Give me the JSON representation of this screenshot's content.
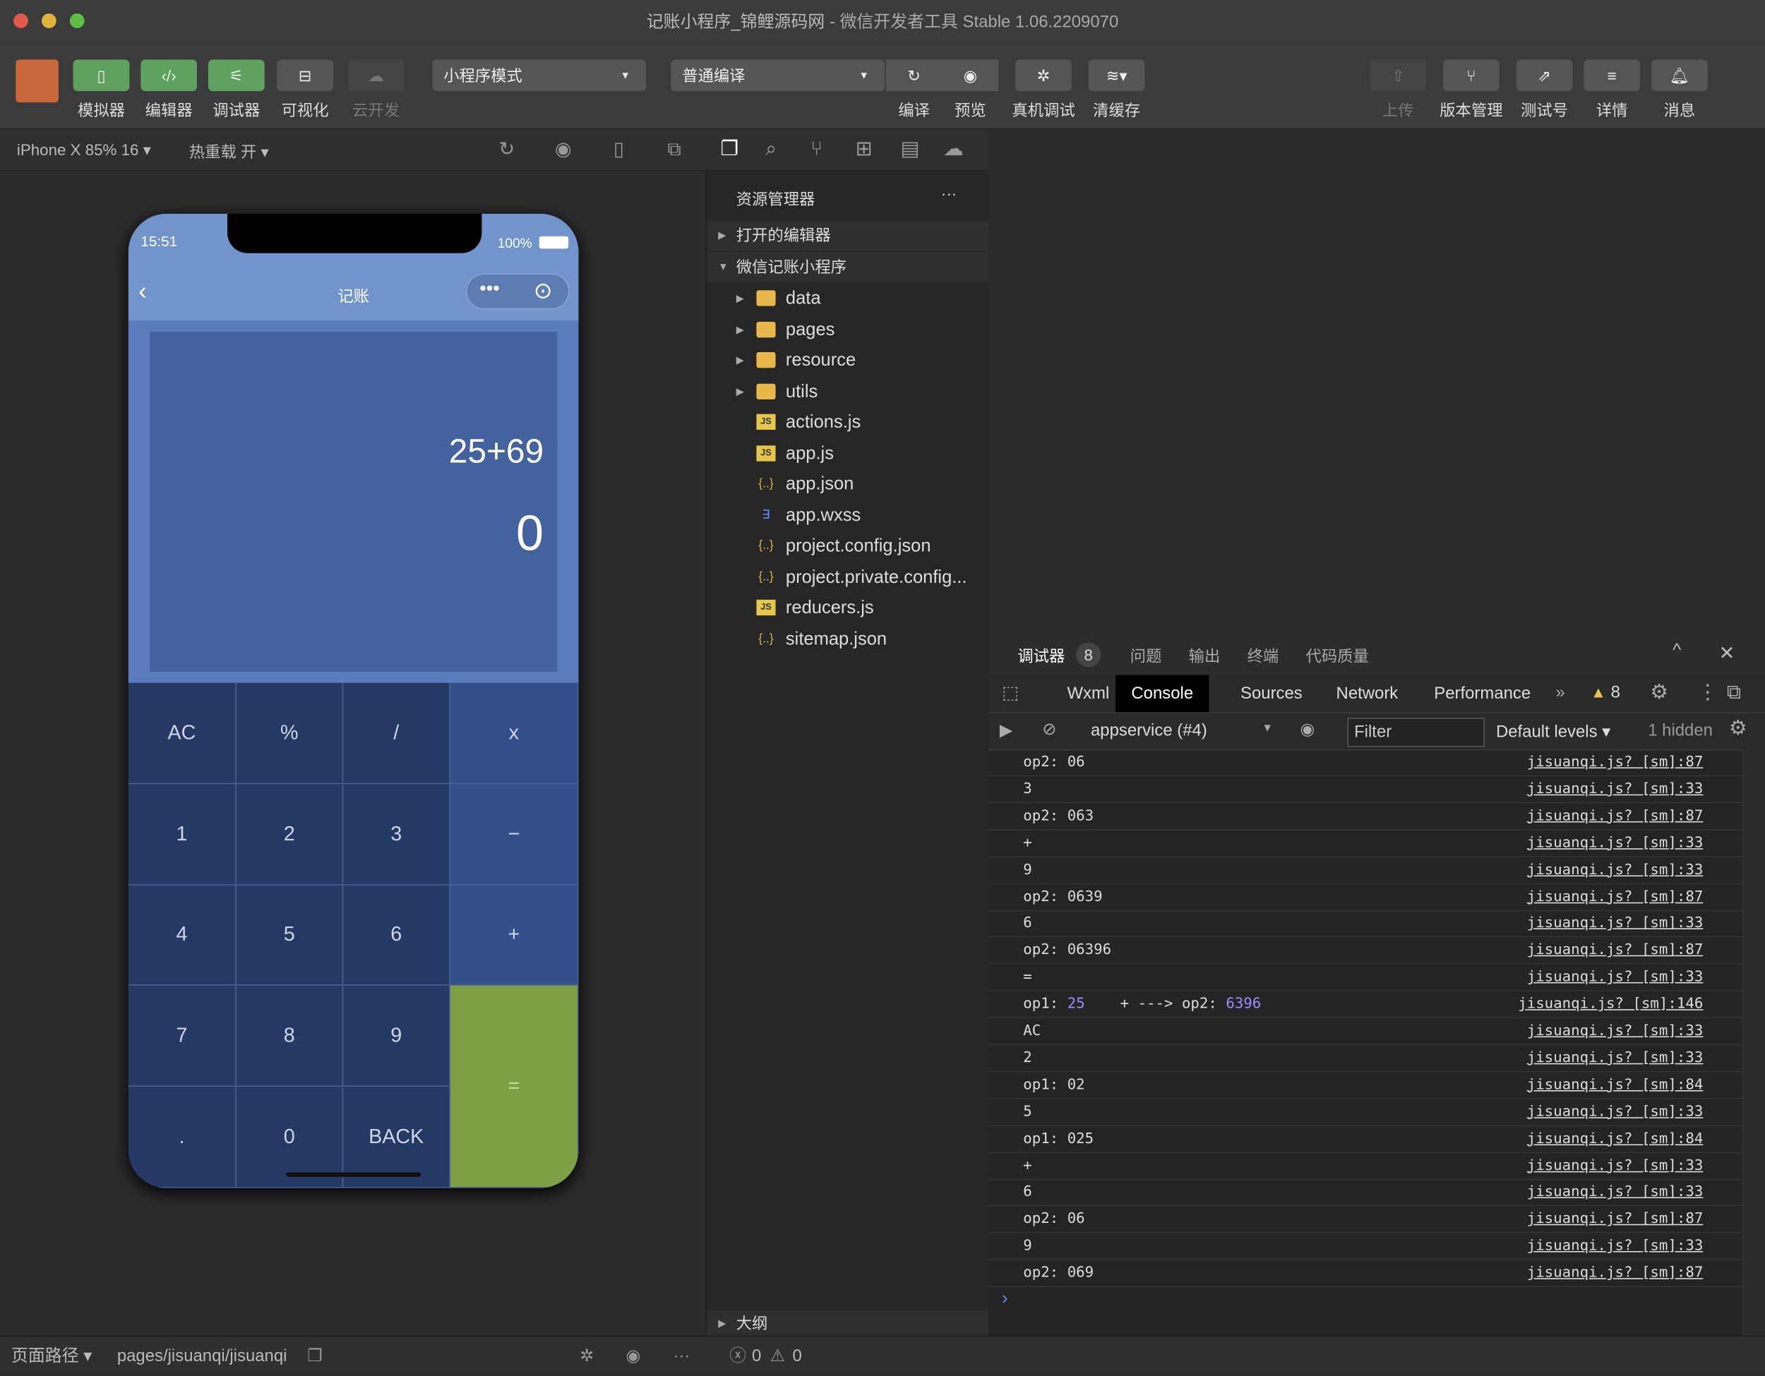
{
  "window": {
    "title": "记账小程序_锦鲤源码网",
    "subtitle": " - 微信开发者工具 Stable 1.06.2209070"
  },
  "toolbar": {
    "left": [
      {
        "label": "模拟器",
        "icon": "phone-icon"
      },
      {
        "label": "编辑器",
        "icon": "code-icon"
      },
      {
        "label": "调试器",
        "icon": "debug-icon"
      },
      {
        "label": "可视化",
        "icon": "layout-icon"
      },
      {
        "label": "云开发",
        "icon": "cloud-icon"
      }
    ],
    "mode_select": "小程序模式",
    "compile_select": "普通编译",
    "mid": [
      {
        "label": "编译",
        "icon": "refresh-icon"
      },
      {
        "label": "预览",
        "icon": "eye-icon"
      },
      {
        "label": "真机调试",
        "icon": "bug-icon"
      },
      {
        "label": "清缓存",
        "icon": "layers-icon"
      }
    ],
    "right": [
      {
        "label": "上传",
        "icon": "upload-icon"
      },
      {
        "label": "版本管理",
        "icon": "branch-icon"
      },
      {
        "label": "测试号",
        "icon": "external-icon"
      },
      {
        "label": "详情",
        "icon": "menu-icon"
      },
      {
        "label": "消息",
        "icon": "bell-icon"
      }
    ]
  },
  "simulator": {
    "device": "iPhone X 85% 16 ▾",
    "hot_reload": "热重载 开 ▾",
    "phone": {
      "time": "15:51",
      "battery": "100%",
      "nav_title": "记账",
      "expression": "25+69",
      "result": "0",
      "keys": [
        [
          "AC",
          "%",
          "/",
          "x"
        ],
        [
          "1",
          "2",
          "3",
          "−"
        ],
        [
          "4",
          "5",
          "6",
          "+"
        ],
        [
          "7",
          "8",
          "9",
          "="
        ],
        [
          ".",
          "0",
          "BACK"
        ]
      ]
    }
  },
  "explorer": {
    "title": "资源管理器",
    "more": "···",
    "open_editors": "打开的编辑器",
    "project": "微信记账小程序",
    "items": [
      {
        "name": "data",
        "type": "folder"
      },
      {
        "name": "pages",
        "type": "folder"
      },
      {
        "name": "resource",
        "type": "folder"
      },
      {
        "name": "utils",
        "type": "folder"
      },
      {
        "name": "actions.js",
        "type": "js"
      },
      {
        "name": "app.js",
        "type": "js"
      },
      {
        "name": "app.json",
        "type": "json"
      },
      {
        "name": "app.wxss",
        "type": "css"
      },
      {
        "name": "project.config.json",
        "type": "json"
      },
      {
        "name": "project.private.config...",
        "type": "json"
      },
      {
        "name": "reducers.js",
        "type": "js"
      },
      {
        "name": "sitemap.json",
        "type": "json"
      }
    ],
    "outline": "大纲",
    "errors": "0",
    "warnings": "0"
  },
  "devtools": {
    "panel_tabs": [
      {
        "label": "调试器",
        "badge": "8"
      },
      {
        "label": "问题"
      },
      {
        "label": "输出"
      },
      {
        "label": "终端"
      },
      {
        "label": "代码质量"
      }
    ],
    "tabs": [
      "Wxml",
      "Console",
      "Sources",
      "Network",
      "Performance"
    ],
    "active_tab": "Console",
    "more": "»",
    "warning_count": "8",
    "context": "appservice (#4)",
    "filter_placeholder": "Filter",
    "levels": "Default levels ▾",
    "hidden": "1 hidden",
    "logs": [
      {
        "msg": "op2: 06",
        "src": "jisuanqi.js? [sm]:87"
      },
      {
        "msg": "3",
        "src": "jisuanqi.js? [sm]:33"
      },
      {
        "msg": "op2: 063",
        "src": "jisuanqi.js? [sm]:87"
      },
      {
        "msg": "+",
        "src": "jisuanqi.js? [sm]:33"
      },
      {
        "msg": "9",
        "src": "jisuanqi.js? [sm]:33"
      },
      {
        "msg": "op2: 0639",
        "src": "jisuanqi.js? [sm]:87"
      },
      {
        "msg": "6",
        "src": "jisuanqi.js? [sm]:33"
      },
      {
        "msg": "op2: 06396",
        "src": "jisuanqi.js? [sm]:87"
      },
      {
        "msg": "=",
        "src": "jisuanqi.js? [sm]:33"
      },
      {
        "msg": "op1: ",
        "n1": "25",
        "mid": "    + ---> op2: ",
        "n2": "6396",
        "src": "jisuanqi.js? [sm]:146"
      },
      {
        "msg": "AC",
        "src": "jisuanqi.js? [sm]:33"
      },
      {
        "msg": "2",
        "src": "jisuanqi.js? [sm]:33"
      },
      {
        "msg": "op1: 02",
        "src": "jisuanqi.js? [sm]:84"
      },
      {
        "msg": "5",
        "src": "jisuanqi.js? [sm]:33"
      },
      {
        "msg": "op1: 025",
        "src": "jisuanqi.js? [sm]:84"
      },
      {
        "msg": "+",
        "src": "jisuanqi.js? [sm]:33"
      },
      {
        "msg": "6",
        "src": "jisuanqi.js? [sm]:33"
      },
      {
        "msg": "op2: 06",
        "src": "jisuanqi.js? [sm]:87"
      },
      {
        "msg": "9",
        "src": "jisuanqi.js? [sm]:33"
      },
      {
        "msg": "op2: 069",
        "src": "jisuanqi.js? [sm]:87"
      }
    ],
    "prompt": "›"
  },
  "statusbar": {
    "path_label": "页面路径 ▾",
    "path": "pages/jisuanqi/jisuanqi"
  }
}
